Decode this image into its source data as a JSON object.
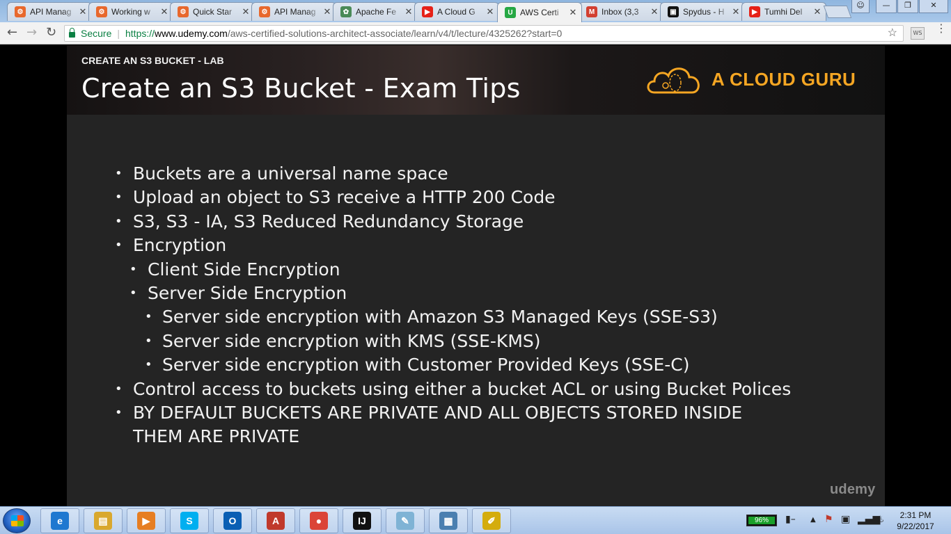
{
  "browser": {
    "tabs": [
      {
        "title": "API Manag",
        "icon": "postman-icon",
        "color": "#e8682c",
        "glyph": "⚙"
      },
      {
        "title": "Working w",
        "icon": "postman-icon",
        "color": "#e8682c",
        "glyph": "⚙"
      },
      {
        "title": "Quick Star",
        "icon": "postman-icon",
        "color": "#e8682c",
        "glyph": "⚙"
      },
      {
        "title": "API Manag",
        "icon": "postman-icon",
        "color": "#e8682c",
        "glyph": "⚙"
      },
      {
        "title": "Apache Fe",
        "icon": "apache-icon",
        "color": "#4a8a57",
        "glyph": "✿"
      },
      {
        "title": "A Cloud G",
        "icon": "youtube-icon",
        "color": "#e62117",
        "glyph": "▶"
      },
      {
        "title": "AWS Certi",
        "icon": "udemy-icon",
        "color": "#27a844",
        "glyph": "U"
      },
      {
        "title": "Inbox (3,3",
        "icon": "gmail-icon",
        "color": "#d23f31",
        "glyph": "M"
      },
      {
        "title": "Spydus - H",
        "icon": "spydus-icon",
        "color": "#111111",
        "glyph": "▣"
      },
      {
        "title": "Tumhi Del",
        "icon": "youtube-icon",
        "color": "#e62117",
        "glyph": "▶"
      }
    ],
    "active_tab": 6,
    "secure_label": "Secure",
    "url_scheme": "https://",
    "url_host": "www.udemy.com",
    "url_path": "/aws-certified-solutions-architect-associate/learn/v4/t/lecture/4325262?start=0",
    "ext_label": "WS"
  },
  "slide": {
    "lab_label": "CREATE AN S3 BUCKET - LAB",
    "title": "Create an S3 Bucket - Exam Tips",
    "brand": "A CLOUD GURU",
    "watermark": "udemy",
    "bullets": [
      {
        "level": 0,
        "text": "Buckets are a universal name space"
      },
      {
        "level": 0,
        "text": "Upload an object to S3 receive a HTTP 200 Code"
      },
      {
        "level": 0,
        "text": "S3, S3 - IA, S3 Reduced Redundancy Storage"
      },
      {
        "level": 0,
        "text": "Encryption"
      },
      {
        "level": 1,
        "text": "Client Side Encryption"
      },
      {
        "level": 1,
        "text": "Server Side Encryption"
      },
      {
        "level": 2,
        "text": "Server side encryption with Amazon S3 Managed Keys (SSE-S3)"
      },
      {
        "level": 2,
        "text": "Server side encryption with KMS (SSE-KMS)"
      },
      {
        "level": 2,
        "text": "Server side encryption with Customer Provided Keys (SSE-C)"
      },
      {
        "level": 0,
        "text": "Control access to buckets using either a bucket ACL or using Bucket Polices"
      },
      {
        "level": 0,
        "text": "BY DEFAULT BUCKETS ARE PRIVATE AND ALL OBJECTS STORED INSIDE"
      },
      {
        "level": -1,
        "text": "THEM ARE PRIVATE"
      }
    ]
  },
  "taskbar": {
    "apps": [
      {
        "name": "internet-explorer",
        "color": "#1e78d0",
        "glyph": "e"
      },
      {
        "name": "file-explorer",
        "color": "#d9a82e",
        "glyph": "▤"
      },
      {
        "name": "media-player",
        "color": "#e67e22",
        "glyph": "▶"
      },
      {
        "name": "skype",
        "color": "#00aff0",
        "glyph": "S"
      },
      {
        "name": "outlook",
        "color": "#0a5fb4",
        "glyph": "O"
      },
      {
        "name": "acrobat-reader",
        "color": "#c0392b",
        "glyph": "A"
      },
      {
        "name": "chrome",
        "color": "#db4437",
        "glyph": "●"
      },
      {
        "name": "intellij",
        "color": "#111111",
        "glyph": "IJ"
      },
      {
        "name": "notepad",
        "color": "#7fb3d5",
        "glyph": "✎"
      },
      {
        "name": "photo-viewer",
        "color": "#4a7fb0",
        "glyph": "▦"
      },
      {
        "name": "paint",
        "color": "#d4ac0d",
        "glyph": "✐"
      }
    ],
    "battery": "96%",
    "time": "2:31 PM",
    "date": "9/22/2017"
  }
}
